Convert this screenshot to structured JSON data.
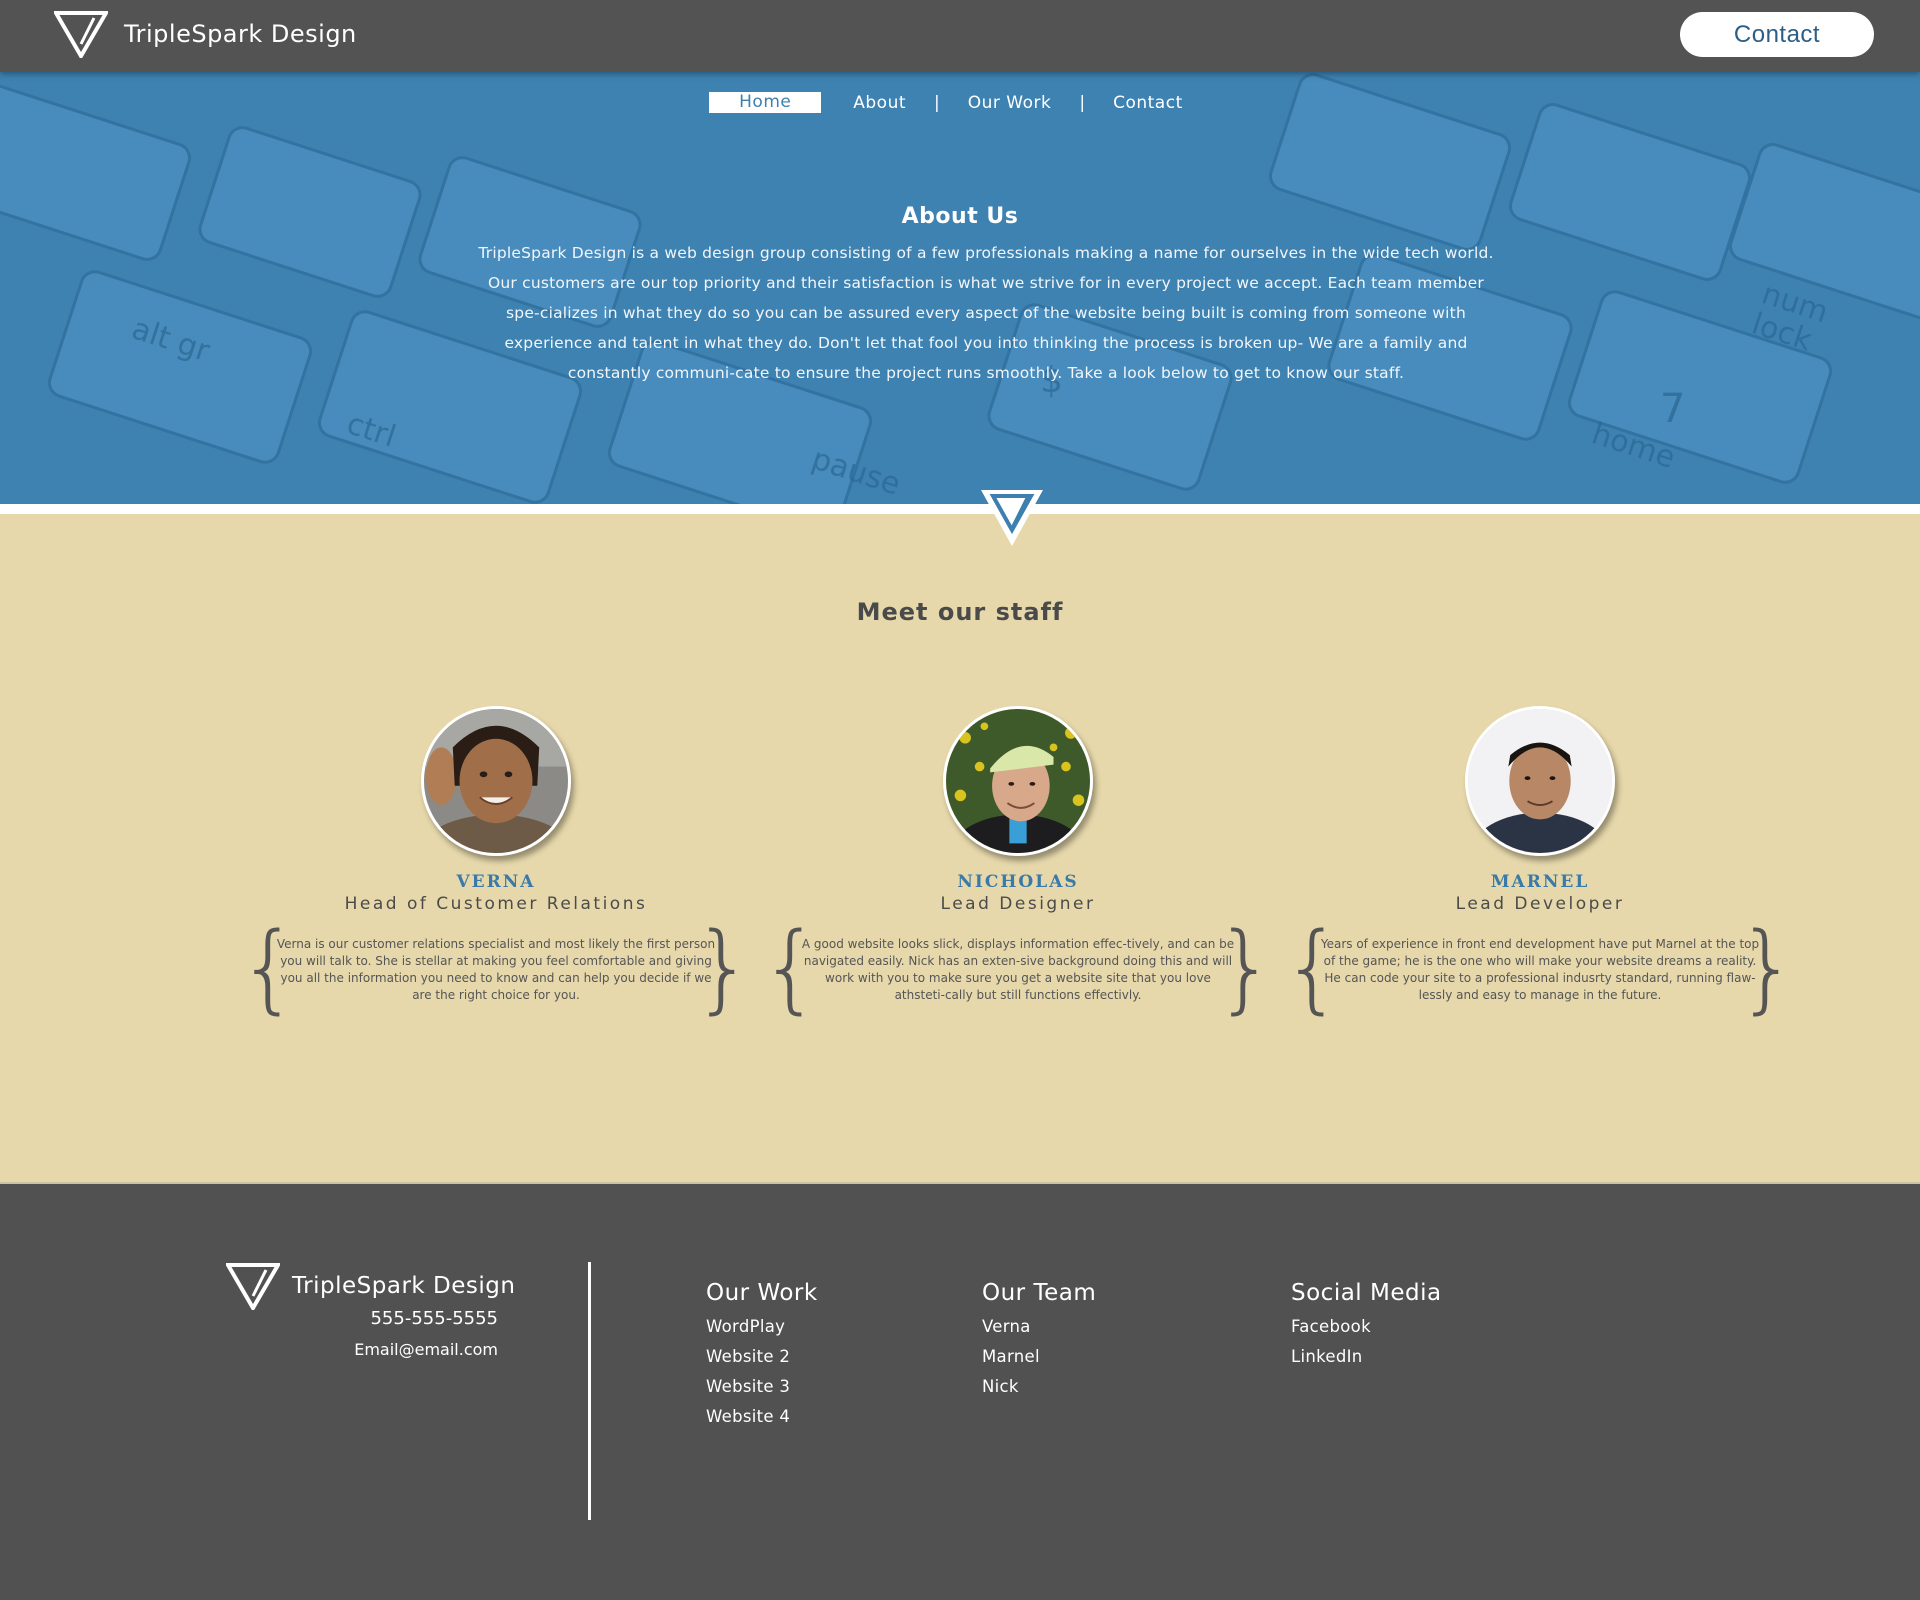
{
  "header": {
    "brand": "TripleSpark Design",
    "contact_button": "Contact"
  },
  "nav": {
    "items": [
      "Home",
      "About",
      "Our Work",
      "Contact"
    ],
    "active": "Home",
    "separator": "|"
  },
  "about": {
    "title": "About Us",
    "text": "TripleSpark Design is a web design group consisting of a few professionals making a name for ourselves in the wide tech world. Our customers are our top priority and their satisfaction is what we strive for in every project we accept. Each team member spe-cializes in what they do so you can be assured every aspect of the website being built is coming from someone with experience and talent in what they do. Don't let that fool you into thinking the process is broken up- We are a family and constantly communi-cate to ensure the project runs smoothly. Take a look below to get to know our staff."
  },
  "staff": {
    "title": "Meet our staff",
    "members": [
      {
        "name": "VERNA",
        "role": "Head of Customer Relations",
        "desc": "Verna is our customer relations specialist and most likely the first person you will talk to. She is stellar at making you feel comfortable and giving you all the information you need to know and can help you decide if we are the right choice for you."
      },
      {
        "name": "NICHOLAS",
        "role": "Lead Designer",
        "desc": "A good website looks slick, displays information effec-tively, and can be navigated easily. Nick has an exten-sive background doing this and will work with you to make sure you get a website site that you love athsteti-cally but still functions effectivly."
      },
      {
        "name": "MARNEL",
        "role": "Lead Developer",
        "desc": "Years of experience in front end development have put Marnel at the top of the game; he is the one who will make your website dreams a reality. He can code your site to a professional indusrty standard, running flaw-lessly and easy to manage in the future."
      }
    ]
  },
  "footer": {
    "brand": "TripleSpark Design",
    "phone": "555-555-5555",
    "email": "Email@email.com",
    "columns": [
      {
        "title": "Our Work",
        "links": [
          "WordPlay",
          "Website 2",
          "Website 3",
          "Website 4"
        ]
      },
      {
        "title": "Our Team",
        "links": [
          "Verna",
          "Marnel",
          "Nick"
        ]
      },
      {
        "title": "Social Media",
        "links": [
          "Facebook",
          "LinkedIn"
        ]
      }
    ]
  },
  "colors": {
    "header_bg": "#535353",
    "hero_blue": "#3d80b0",
    "staff_bg": "#e6d8ab",
    "accent_name": "#3a7aa8",
    "footer_bg": "#515151"
  },
  "icons": [
    "triangle-logo-icon",
    "divider-triangle-icon"
  ]
}
